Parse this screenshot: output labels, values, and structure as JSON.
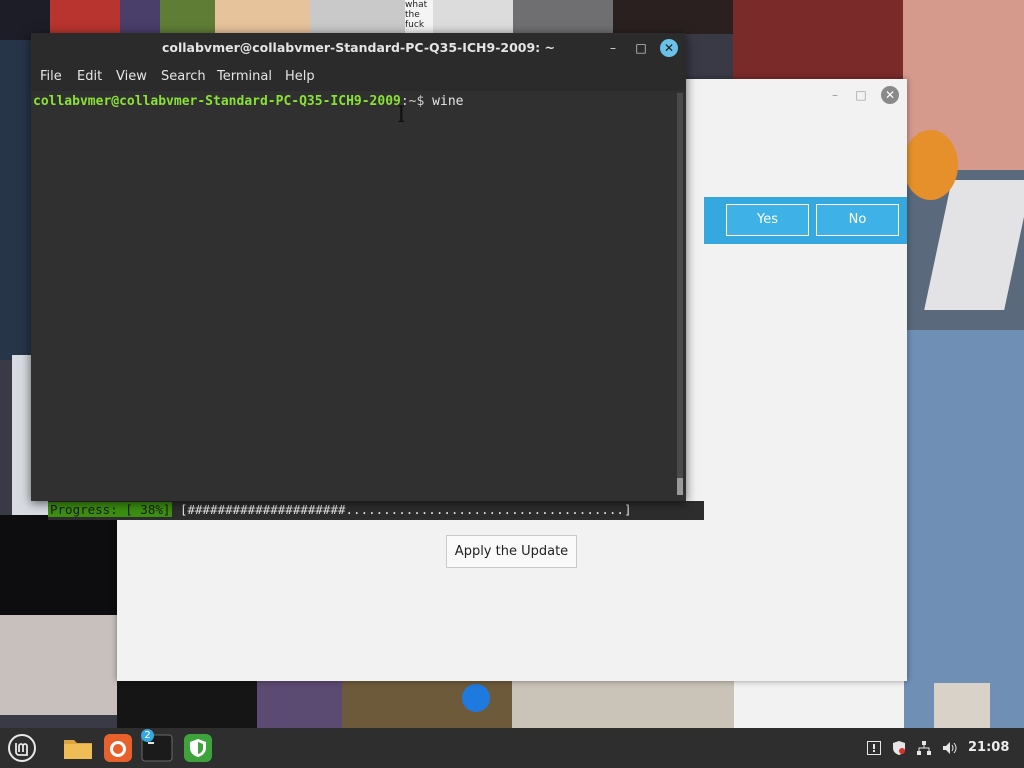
{
  "terminal": {
    "title": "collabvmer@collabvmer-Standard-PC-Q35-ICH9-2009: ~",
    "menu": [
      "File",
      "Edit",
      "View",
      "Search",
      "Terminal",
      "Help"
    ],
    "prompt_user": "collabvmer@collabvmer-Standard-PC-Q35-ICH9-2009",
    "prompt_path": ":~$ ",
    "command": "wine"
  },
  "dialog": {
    "yes_label": "Yes",
    "no_label": "No",
    "apply_label": "Apply the Update",
    "progress_label": "Progress: [ 38%]",
    "progress_bar": " [#####################.....................................]",
    "progress_percent": 38
  },
  "wallpaper_text": {
    "tile_a": "what the fuck"
  },
  "taskbar": {
    "terminal_badge": "2",
    "clock": "21:08"
  },
  "colors": {
    "accent": "#35a9df",
    "terminal_bg": "#303030",
    "prompt_user": "#8ae234",
    "progress_green": "#3c8f10"
  },
  "icons": {
    "menu": "linux-mint-logo-icon",
    "files": "folder-icon",
    "browser": "firefox-icon",
    "terminal": "terminal-icon",
    "shield": "shield-icon",
    "tray": [
      "update-manager-icon",
      "shield-tray-icon",
      "network-icon",
      "volume-icon"
    ]
  }
}
